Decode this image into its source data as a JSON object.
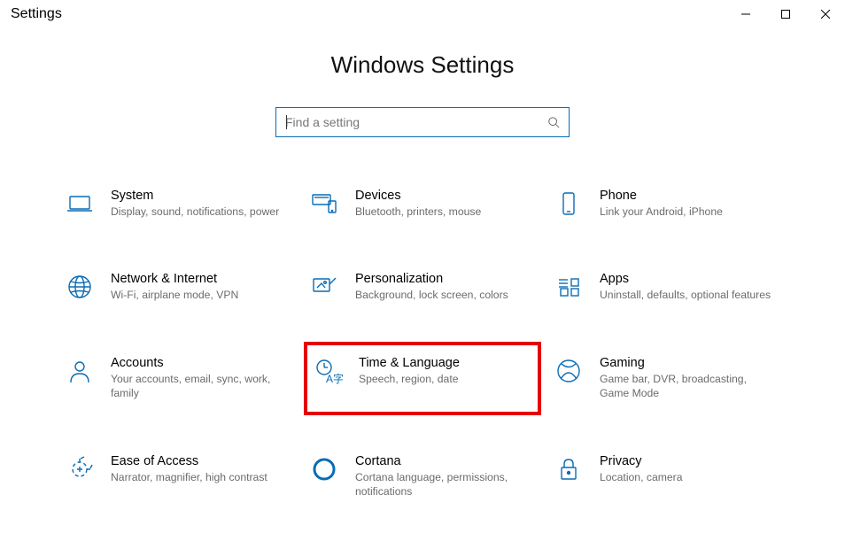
{
  "window": {
    "title": "Settings"
  },
  "header": {
    "title": "Windows Settings"
  },
  "search": {
    "placeholder": "Find a setting",
    "value": ""
  },
  "categories": [
    {
      "id": "system",
      "title": "System",
      "desc": "Display, sound, notifications, power",
      "icon": "laptop",
      "highlight": false
    },
    {
      "id": "devices",
      "title": "Devices",
      "desc": "Bluetooth, printers, mouse",
      "icon": "devices",
      "highlight": false
    },
    {
      "id": "phone",
      "title": "Phone",
      "desc": "Link your Android, iPhone",
      "icon": "phone",
      "highlight": false
    },
    {
      "id": "network",
      "title": "Network & Internet",
      "desc": "Wi-Fi, airplane mode, VPN",
      "icon": "globe",
      "highlight": false
    },
    {
      "id": "personalization",
      "title": "Personalization",
      "desc": "Background, lock screen, colors",
      "icon": "brush",
      "highlight": false
    },
    {
      "id": "apps",
      "title": "Apps",
      "desc": "Uninstall, defaults, optional features",
      "icon": "apps",
      "highlight": false
    },
    {
      "id": "accounts",
      "title": "Accounts",
      "desc": "Your accounts, email, sync, work, family",
      "icon": "person",
      "highlight": false
    },
    {
      "id": "time-language",
      "title": "Time & Language",
      "desc": "Speech, region, date",
      "icon": "clock-lang",
      "highlight": true
    },
    {
      "id": "gaming",
      "title": "Gaming",
      "desc": "Game bar, DVR, broadcasting, Game Mode",
      "icon": "xbox",
      "highlight": false
    },
    {
      "id": "ease-of-access",
      "title": "Ease of Access",
      "desc": "Narrator, magnifier, high contrast",
      "icon": "ease",
      "highlight": false
    },
    {
      "id": "cortana",
      "title": "Cortana",
      "desc": "Cortana language, permissions, notifications",
      "icon": "cortana",
      "highlight": false
    },
    {
      "id": "privacy",
      "title": "Privacy",
      "desc": "Location, camera",
      "icon": "lock",
      "highlight": false
    }
  ]
}
